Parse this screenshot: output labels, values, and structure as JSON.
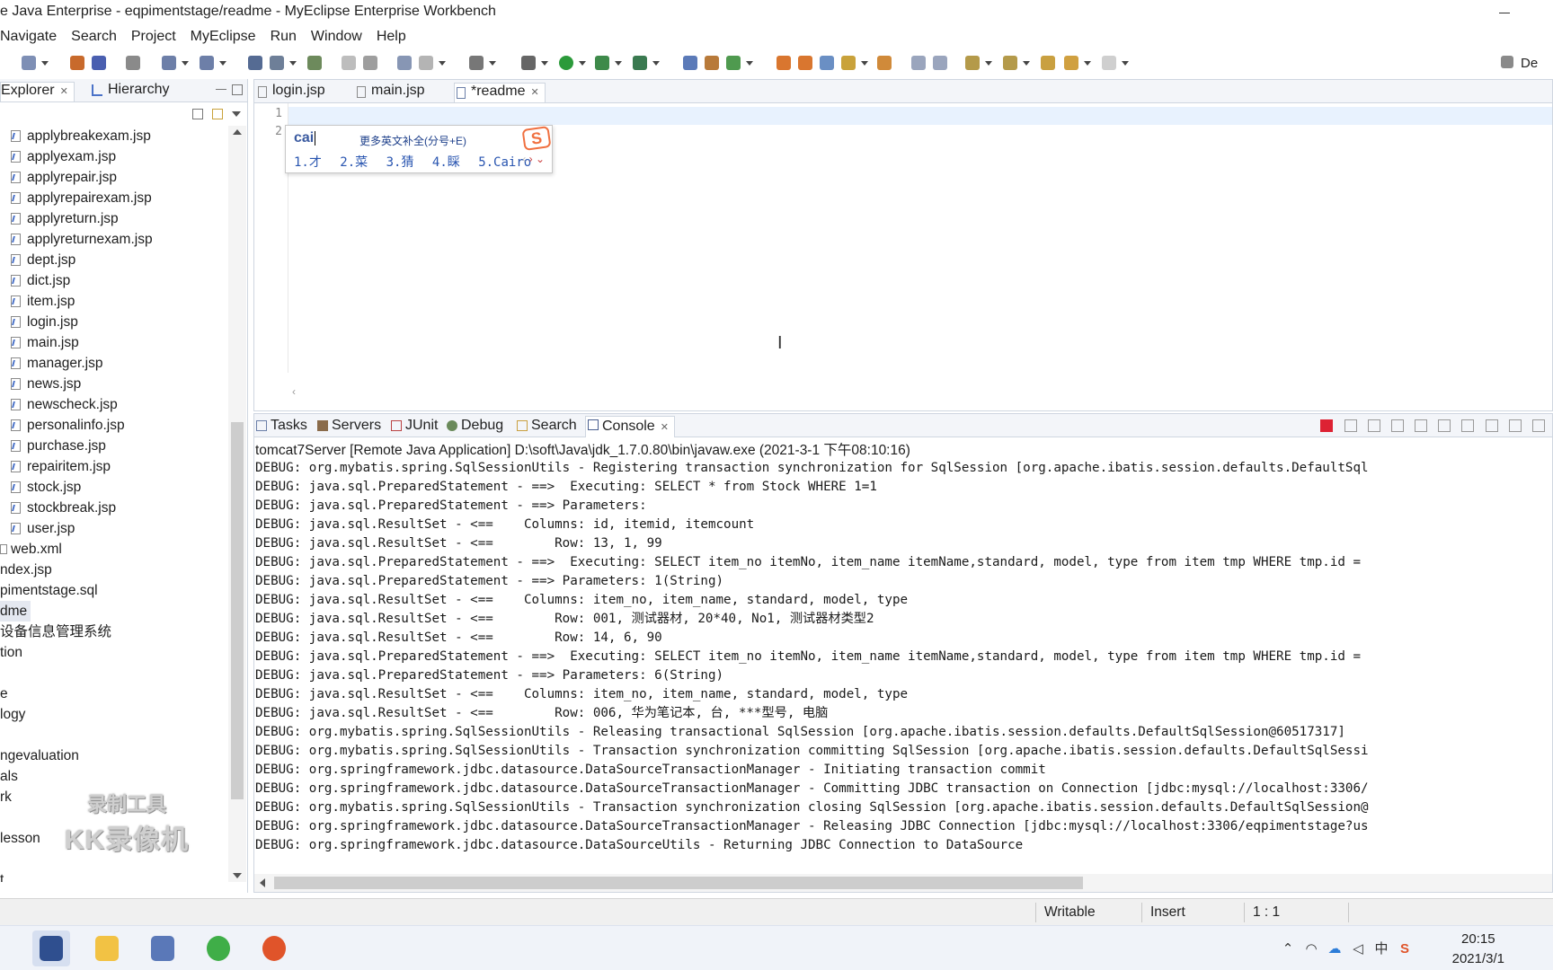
{
  "window": {
    "title": "e Java Enterprise - eqpimentstage/readme - MyEclipse Enterprise Workbench"
  },
  "menu": [
    "Navigate",
    "Search",
    "Project",
    "MyEclipse",
    "Run",
    "Window",
    "Help"
  ],
  "toolbar": {
    "perspective_label": "De"
  },
  "left_panel": {
    "tabs": [
      {
        "label": "Explorer",
        "closable": true,
        "active": true
      },
      {
        "label": "Hierarchy",
        "closable": false,
        "active": false
      }
    ],
    "files": [
      "applybreakexam.jsp",
      "applyexam.jsp",
      "applyrepair.jsp",
      "applyrepairexam.jsp",
      "applyreturn.jsp",
      "applyreturnexam.jsp",
      "dept.jsp",
      "dict.jsp",
      "item.jsp",
      "login.jsp",
      "main.jsp",
      "manager.jsp",
      "news.jsp",
      "newscheck.jsp",
      "personalinfo.jsp",
      "purchase.jsp",
      "repairitem.jsp",
      "stock.jsp",
      "stockbreak.jsp",
      "user.jsp"
    ],
    "xml_item": "web.xml",
    "other_items": [
      "ndex.jsp",
      "pimentstage.sql",
      "dme",
      "设备信息管理系统",
      "tion",
      "",
      "e",
      "logy",
      "",
      "ngevaluation",
      "als",
      "rk",
      "",
      "lesson",
      "",
      "t"
    ],
    "selected_item": "dme"
  },
  "watermark": {
    "line1": "录制工具",
    "line2": "KK录像机"
  },
  "editor": {
    "tabs": [
      {
        "label": "login.jsp",
        "active": false
      },
      {
        "label": "main.jsp",
        "active": false
      },
      {
        "label": "*readme",
        "active": true
      }
    ],
    "line_numbers": [
      "1",
      "2"
    ],
    "ime": {
      "input": "cai",
      "hint": "更多英文补全(分号+E)",
      "candidates": [
        "1.才",
        "2.菜",
        "3.猜",
        "4.睬",
        "5.Cairo"
      ],
      "logo": "S"
    }
  },
  "console": {
    "tabs": [
      {
        "label": "Tasks",
        "icon": "tasks-icon"
      },
      {
        "label": "Servers",
        "icon": "servers-icon"
      },
      {
        "label": "JUnit",
        "icon": "junit-icon"
      },
      {
        "label": "Debug",
        "icon": "debug-icon"
      },
      {
        "label": "Search",
        "icon": "search-icon"
      },
      {
        "label": "Console",
        "icon": "console-icon",
        "active": true,
        "closable": true
      }
    ],
    "description": "tomcat7Server [Remote Java Application] D:\\soft\\Java\\jdk_1.7.0.80\\bin\\javaw.exe (2021-3-1 下午08:10:16)",
    "lines": [
      "DEBUG: org.mybatis.spring.SqlSessionUtils - Registering transaction synchronization for SqlSession [org.apache.ibatis.session.defaults.DefaultSql",
      "DEBUG: java.sql.PreparedStatement - ==>  Executing: SELECT * from Stock WHERE 1=1",
      "DEBUG: java.sql.PreparedStatement - ==> Parameters: ",
      "DEBUG: java.sql.ResultSet - <==    Columns: id, itemid, itemcount",
      "DEBUG: java.sql.ResultSet - <==        Row: 13, 1, 99",
      "DEBUG: java.sql.PreparedStatement - ==>  Executing: SELECT item_no itemNo, item_name itemName,standard, model, type from item tmp WHERE tmp.id = ",
      "DEBUG: java.sql.PreparedStatement - ==> Parameters: 1(String)",
      "DEBUG: java.sql.ResultSet - <==    Columns: item_no, item_name, standard, model, type",
      "DEBUG: java.sql.ResultSet - <==        Row: 001, 测试器材, 20*40, No1, 测试器材类型2",
      "DEBUG: java.sql.ResultSet - <==        Row: 14, 6, 90",
      "DEBUG: java.sql.PreparedStatement - ==>  Executing: SELECT item_no itemNo, item_name itemName,standard, model, type from item tmp WHERE tmp.id = ",
      "DEBUG: java.sql.PreparedStatement - ==> Parameters: 6(String)",
      "DEBUG: java.sql.ResultSet - <==    Columns: item_no, item_name, standard, model, type",
      "DEBUG: java.sql.ResultSet - <==        Row: 006, 华为笔记本, 台, ***型号, 电脑",
      "DEBUG: org.mybatis.spring.SqlSessionUtils - Releasing transactional SqlSession [org.apache.ibatis.session.defaults.DefaultSqlSession@60517317]",
      "DEBUG: org.mybatis.spring.SqlSessionUtils - Transaction synchronization committing SqlSession [org.apache.ibatis.session.defaults.DefaultSqlSessi",
      "DEBUG: org.springframework.jdbc.datasource.DataSourceTransactionManager - Initiating transaction commit",
      "DEBUG: org.springframework.jdbc.datasource.DataSourceTransactionManager - Committing JDBC transaction on Connection [jdbc:mysql://localhost:3306/",
      "DEBUG: org.mybatis.spring.SqlSessionUtils - Transaction synchronization closing SqlSession [org.apache.ibatis.session.defaults.DefaultSqlSession@",
      "DEBUG: org.springframework.jdbc.datasource.DataSourceTransactionManager - Releasing JDBC Connection [jdbc:mysql://localhost:3306/eqpimentstage?us",
      "DEBUG: org.springframework.jdbc.datasource.DataSourceUtils - Returning JDBC Connection to DataSource"
    ]
  },
  "status": {
    "writable": "Writable",
    "insert": "Insert",
    "position": "1 : 1"
  },
  "taskbar": {
    "apps": [
      "myeclipse-app",
      "file-explorer-app",
      "archive-app",
      "browser-app",
      "recorder-app"
    ],
    "time": "20:15",
    "date": "2021/3/1",
    "ime_indicator": "中"
  },
  "colors": {
    "console_stop": "#dd2233",
    "editor_current_line": "#e8f2fe",
    "ime_candidate": "#2955b0",
    "ime_logo": "#f07040"
  }
}
